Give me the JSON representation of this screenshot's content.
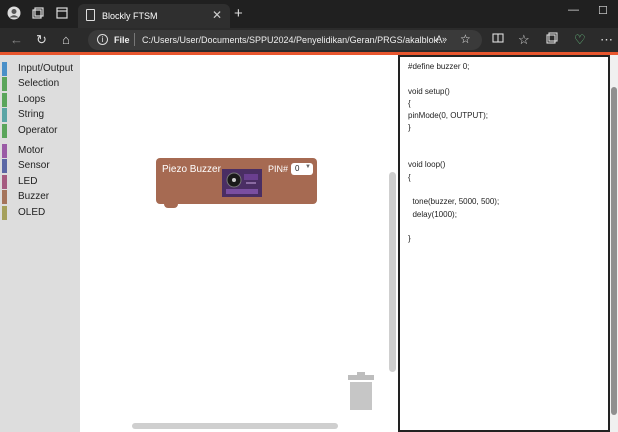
{
  "browser": {
    "tab_title": "Blockly FTSM",
    "tab_close": "✕",
    "new_tab": "+",
    "url_label": "File",
    "url": "C:/Users/User/Documents/SPPU2024/Penyelidikan/Geran/PRGS/akalblok...",
    "read_aloud": "A»",
    "window_controls": [
      "—",
      "☐"
    ]
  },
  "toolbox": {
    "categories": [
      {
        "label": "Input/Output",
        "color": "#4a90c8"
      },
      {
        "label": "Selection",
        "color": "#5ba55b"
      },
      {
        "label": "Loops",
        "color": "#5ba55b"
      },
      {
        "label": "String",
        "color": "#5ba5a5"
      },
      {
        "label": "Operator",
        "color": "#5ba55b"
      },
      {
        "label": "Motor",
        "color": "#9a5ba5"
      },
      {
        "label": "Sensor",
        "color": "#5b67a5"
      },
      {
        "label": "LED",
        "color": "#a55b80"
      },
      {
        "label": "Buzzer",
        "color": "#a5745b"
      },
      {
        "label": "OLED",
        "color": "#a5a05b"
      }
    ]
  },
  "block": {
    "name": "Piezo Buzzer",
    "pin_label": "PIN#",
    "pin_value": "0",
    "color": "#a66a52"
  },
  "code": {
    "text": "#define buzzer 0;\n\nvoid setup()\n{\npinMode(0, OUTPUT);\n}\n\n\nvoid loop()\n{\n\n  tone(buzzer, 5000, 500);\n  delay(1000);\n\n}"
  }
}
